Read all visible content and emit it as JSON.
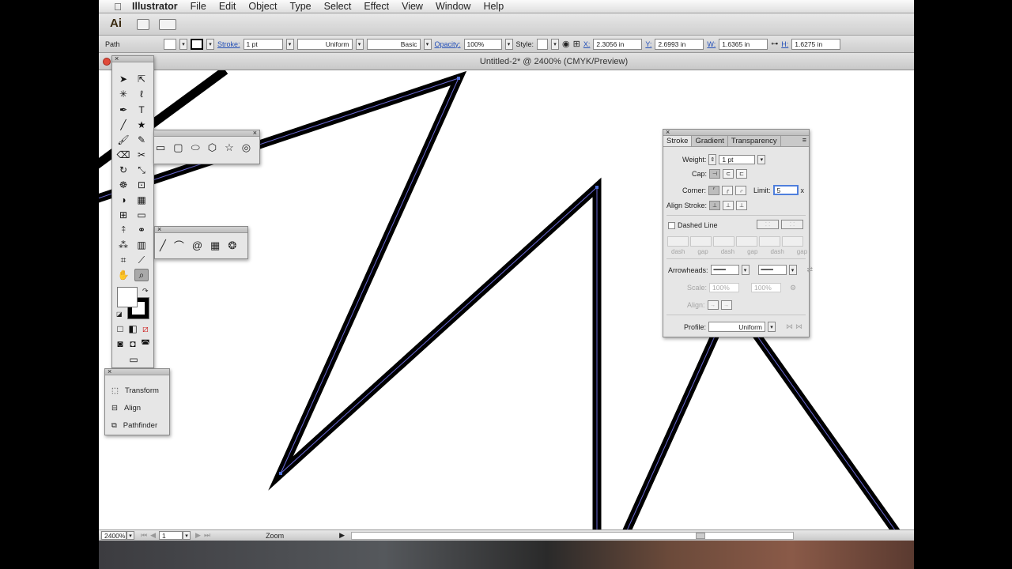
{
  "menubar": {
    "app": "Illustrator",
    "items": [
      "File",
      "Edit",
      "Object",
      "Type",
      "Select",
      "Effect",
      "View",
      "Window",
      "Help"
    ]
  },
  "appbar": {
    "logo": "Ai"
  },
  "control_bar": {
    "selection": "Path",
    "stroke_label": "Stroke:",
    "stroke_weight": "1 pt",
    "profile": "Uniform",
    "brush": "Basic",
    "opacity_label": "Opacity:",
    "opacity": "100%",
    "style_label": "Style:",
    "x_label": "X:",
    "x": "2.3056 in",
    "y_label": "Y:",
    "y": "2.6993 in",
    "w_label": "W:",
    "w": "1.6365 in",
    "h_label": "H:",
    "h": "1.6275 in"
  },
  "document": {
    "title": "Untitled-2* @ 2400% (CMYK/Preview)"
  },
  "statusbar": {
    "zoom": "2400%",
    "artboard": "1",
    "tool": "Zoom"
  },
  "mini_panel": {
    "items": [
      "Transform",
      "Align",
      "Pathfinder"
    ]
  },
  "stroke_panel": {
    "tabs": [
      "Stroke",
      "Gradient",
      "Transparency"
    ],
    "weight_label": "Weight:",
    "weight": "1 pt",
    "cap_label": "Cap:",
    "corner_label": "Corner:",
    "limit_label": "Limit:",
    "limit": "5",
    "limit_suffix": "x",
    "align_label": "Align Stroke:",
    "dashed_label": "Dashed Line",
    "dash_labels": [
      "dash",
      "gap",
      "dash",
      "gap",
      "dash",
      "gap"
    ],
    "arrowheads_label": "Arrowheads:",
    "scale_label": "Scale:",
    "scale1": "100%",
    "scale2": "100%",
    "align2_label": "Align:",
    "profile_label": "Profile:",
    "profile": "Uniform"
  },
  "colors": {
    "path_stroke": "#000000",
    "path_highlight": "#6a6ad8",
    "selection": "#4f6fd6"
  }
}
